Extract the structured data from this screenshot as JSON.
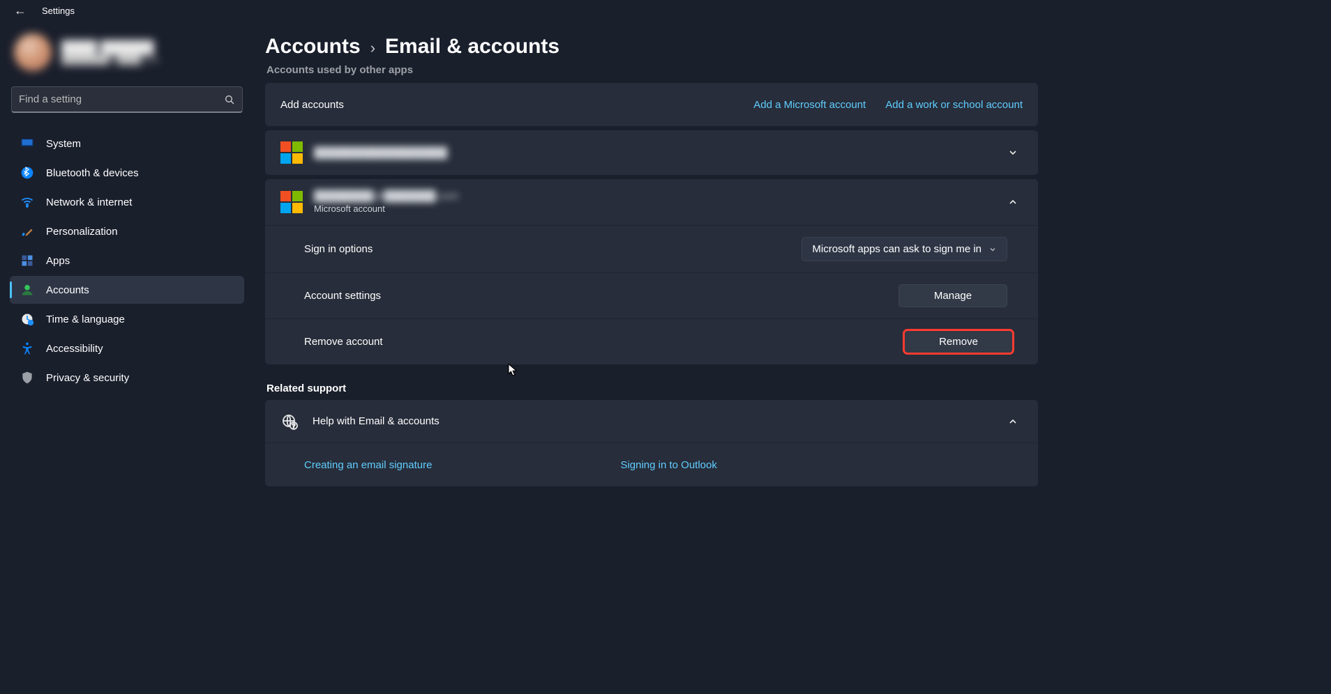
{
  "app_title": "Settings",
  "search_placeholder": "Find a setting",
  "nav": {
    "system": "System",
    "bluetooth": "Bluetooth & devices",
    "network": "Network & internet",
    "personalization": "Personalization",
    "apps": "Apps",
    "accounts": "Accounts",
    "time": "Time & language",
    "accessibility": "Accessibility",
    "privacy": "Privacy & security"
  },
  "breadcrumb": {
    "parent": "Accounts",
    "leaf": "Email & accounts"
  },
  "sections": {
    "used_by_other_apps": "Accounts used by other apps",
    "related_support": "Related support"
  },
  "add_accounts": {
    "label": "Add accounts",
    "add_microsoft": "Add a Microsoft account",
    "add_work": "Add a work or school account"
  },
  "account1": {
    "email": "██████████████████",
    "type": ""
  },
  "account2": {
    "email": "████████@███████.com",
    "type": "Microsoft account"
  },
  "options": {
    "sign_in_label": "Sign in options",
    "sign_in_value": "Microsoft apps can ask to sign me in",
    "settings_label": "Account settings",
    "settings_button": "Manage",
    "remove_label": "Remove account",
    "remove_button": "Remove"
  },
  "help": {
    "title": "Help with Email & accounts",
    "link1": "Creating an email signature",
    "link2": "Signing in to Outlook"
  }
}
